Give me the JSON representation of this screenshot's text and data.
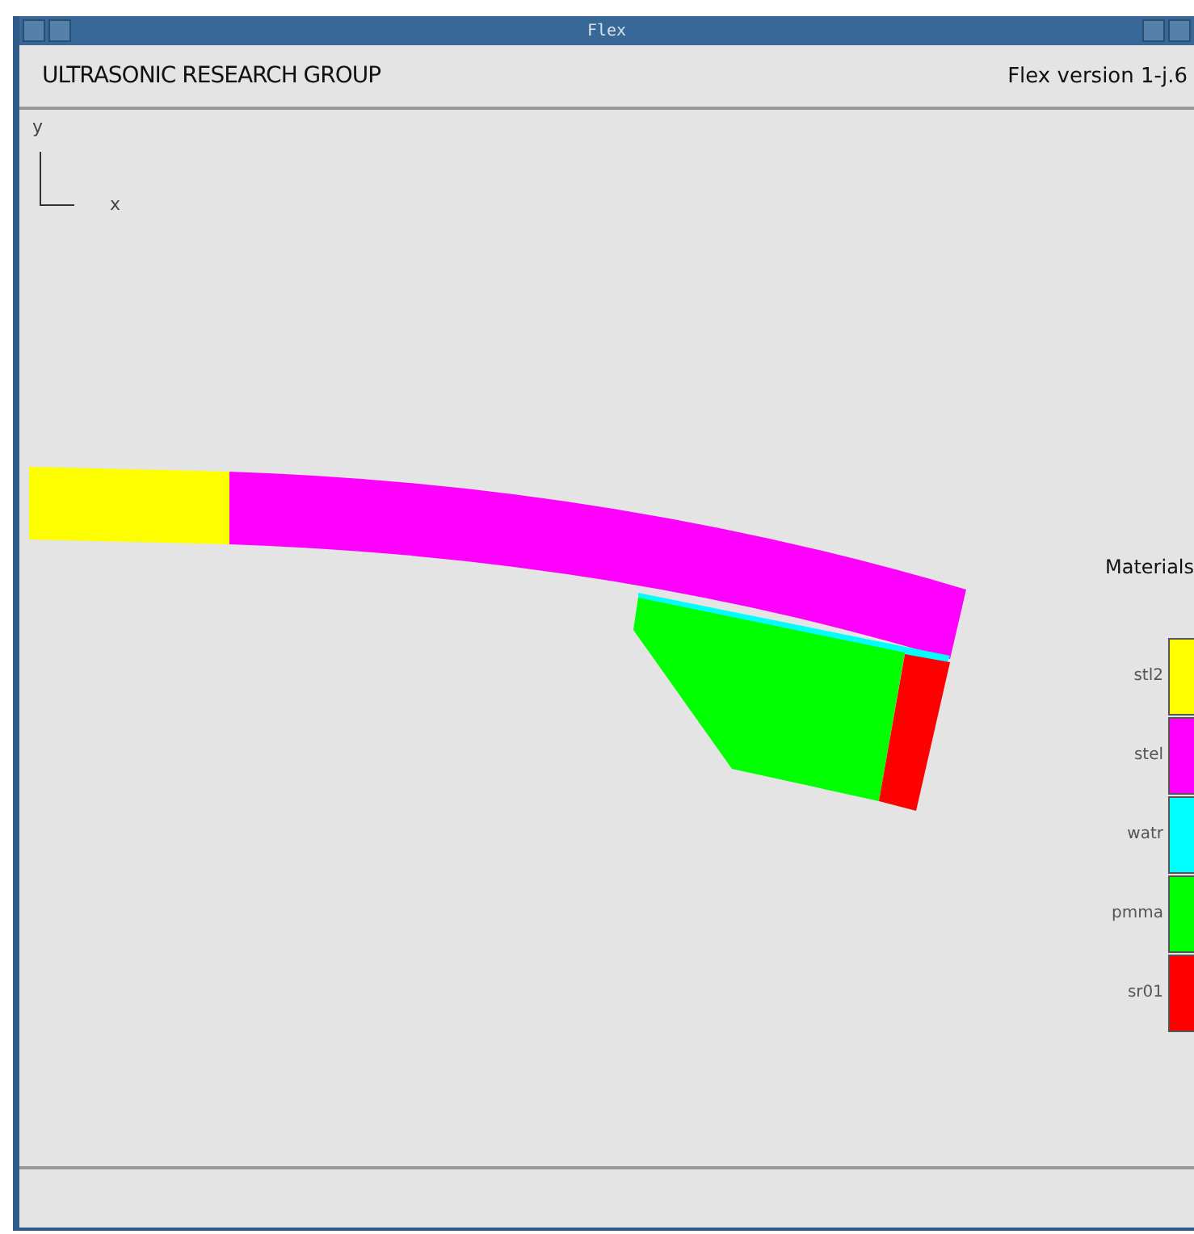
{
  "window": {
    "title": "Flex"
  },
  "header": {
    "group": "ULTRASONIC RESEARCH GROUP",
    "version": "Flex  version  1-j.6"
  },
  "axes": {
    "y": "y",
    "x": "x"
  },
  "legend": {
    "title": "Materials",
    "materials": [
      {
        "name": "stl2",
        "color": "#ffff00"
      },
      {
        "name": "stel",
        "color": "#ff00ff"
      },
      {
        "name": "watr",
        "color": "#00ffff"
      },
      {
        "name": "pmma",
        "color": "#00ff00"
      },
      {
        "name": "sr01",
        "color": "#ff0000"
      }
    ]
  }
}
